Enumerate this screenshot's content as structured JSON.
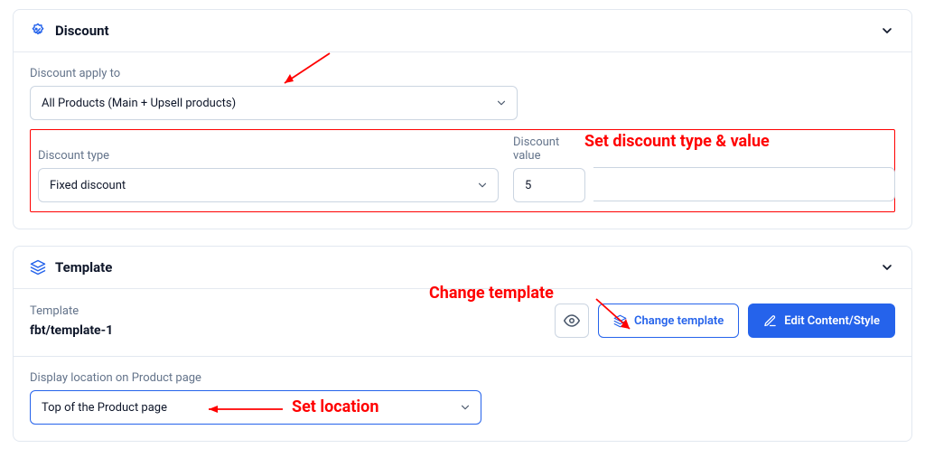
{
  "discount": {
    "section_title": "Discount",
    "apply_to_label": "Discount apply to",
    "apply_to_value": "All Products (Main + Upsell products)",
    "type_label": "Discount type",
    "type_value": "Fixed discount",
    "value_label": "Discount value",
    "value": "5"
  },
  "template": {
    "section_title": "Template",
    "label": "Template",
    "name": "fbt/template-1",
    "change_btn": "Change template",
    "edit_btn": "Edit Content/Style",
    "location_label": "Display location on Product page",
    "location_value": "Top of the Product page"
  },
  "annotations": {
    "set_discount": "Set discount type & value",
    "change_template": "Change template",
    "set_location": "Set location"
  }
}
